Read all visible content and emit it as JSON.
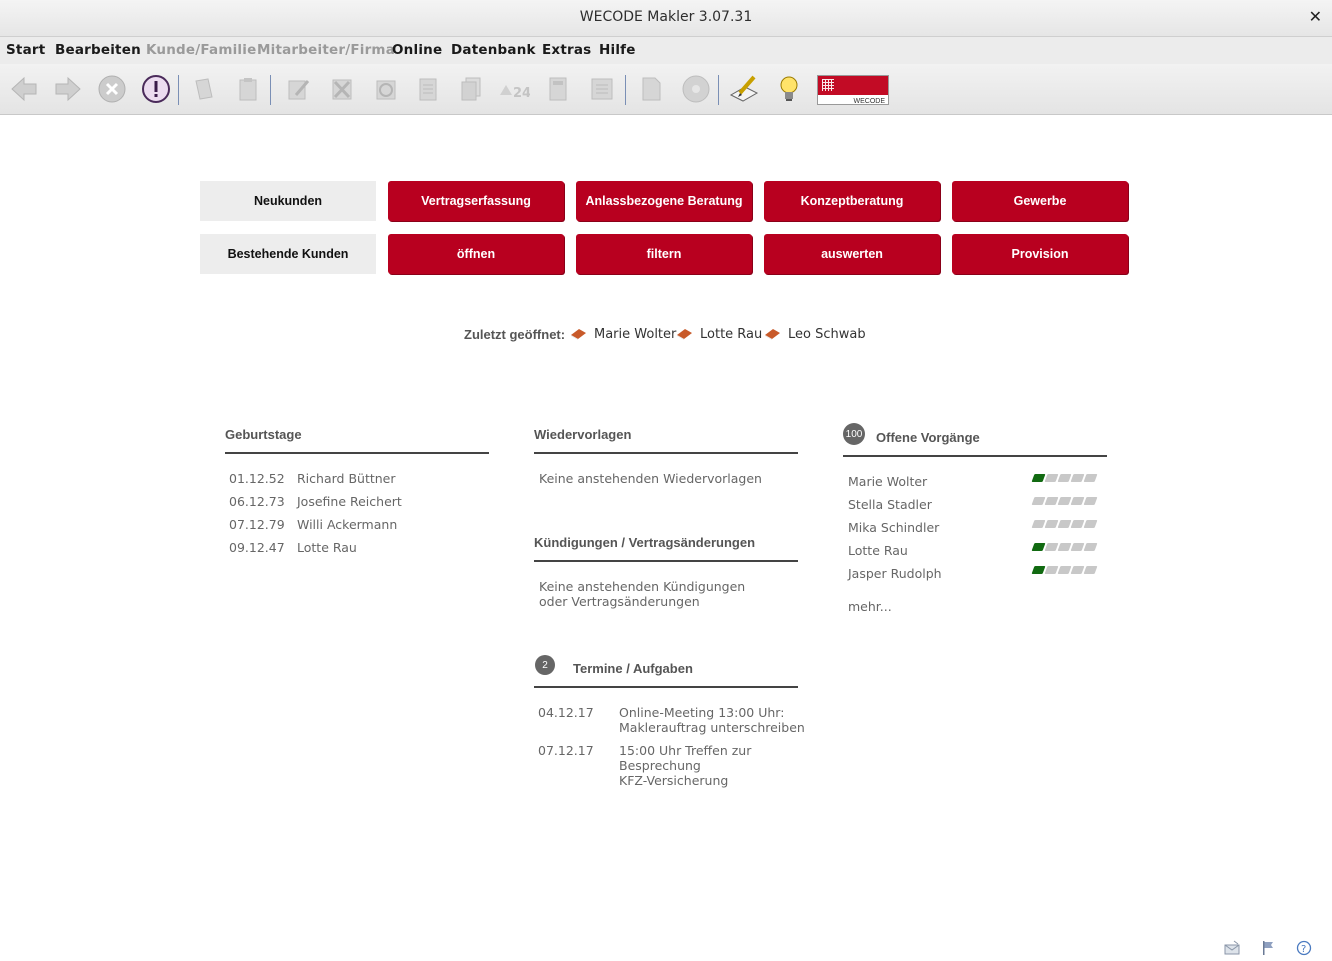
{
  "window": {
    "title": "WECODE Makler 3.07.31",
    "close_symbol": "✕"
  },
  "menu": [
    {
      "label": "Start",
      "disabled": false
    },
    {
      "label": "Bearbeiten",
      "disabled": false
    },
    {
      "label": "Kunde/Familie",
      "disabled": true
    },
    {
      "label": "Mitarbeiter/Firma",
      "disabled": true
    },
    {
      "label": "Online",
      "disabled": false
    },
    {
      "label": "Datenbank",
      "disabled": false
    },
    {
      "label": "Extras",
      "disabled": false
    },
    {
      "label": "Hilfe",
      "disabled": false
    }
  ],
  "logo": {
    "text": "WECODE",
    "color": "#c20b25"
  },
  "actions": {
    "row1_label": "Neukunden",
    "row1": [
      "Vertragserfassung",
      "Anlassbezogene Beratung",
      "Konzeptberatung",
      "Gewerbe"
    ],
    "row2_label": "Bestehende Kunden",
    "row2": [
      "öffnen",
      "filtern",
      "auswerten",
      "Provision"
    ]
  },
  "recent": {
    "label": "Zuletzt geöffnet:",
    "names": [
      "Marie Wolter",
      "Lotte Rau",
      "Leo Schwab"
    ]
  },
  "birthdays": {
    "title": "Geburtstage",
    "items": [
      {
        "date": "01.12.52",
        "name": "Richard Büttner"
      },
      {
        "date": "06.12.73",
        "name": "Josefine Reichert"
      },
      {
        "date": "07.12.79",
        "name": "Willi Ackermann"
      },
      {
        "date": "09.12.47",
        "name": "Lotte Rau"
      }
    ]
  },
  "followups": {
    "title": "Wiedervorlagen",
    "empty": "Keine anstehenden Wiedervorlagen"
  },
  "cancellations": {
    "title": "Kündigungen / Vertragsänderungen",
    "empty_line1": "Keine anstehenden Kündigungen",
    "empty_line2": "oder Vertragsänderungen"
  },
  "appointments": {
    "title": "Termine / Aufgaben",
    "count": "2",
    "items": [
      {
        "date": "04.12.17",
        "lines": [
          "Online-Meeting 13:00 Uhr:",
          "Maklerauftrag unterschreiben"
        ]
      },
      {
        "date": "07.12.17",
        "lines": [
          "15:00 Uhr Treffen zur",
          "Besprechung",
          "KFZ-Versicherung"
        ]
      }
    ]
  },
  "open_processes": {
    "title": "Offene Vorgänge",
    "count": "100",
    "more": "mehr...",
    "items": [
      {
        "name": "Marie Wolter",
        "progress_steps": 1,
        "total_steps": 5
      },
      {
        "name": "Stella Stadler",
        "progress_steps": 0,
        "total_steps": 5
      },
      {
        "name": "Mika Schindler",
        "progress_steps": 0,
        "total_steps": 5
      },
      {
        "name": "Lotte Rau",
        "progress_steps": 1,
        "total_steps": 5
      },
      {
        "name": "Jasper Rudolph",
        "progress_steps": 1,
        "total_steps": 5
      }
    ]
  },
  "colors": {
    "accent_red": "#b8001f",
    "progress_green": "#116a11"
  }
}
